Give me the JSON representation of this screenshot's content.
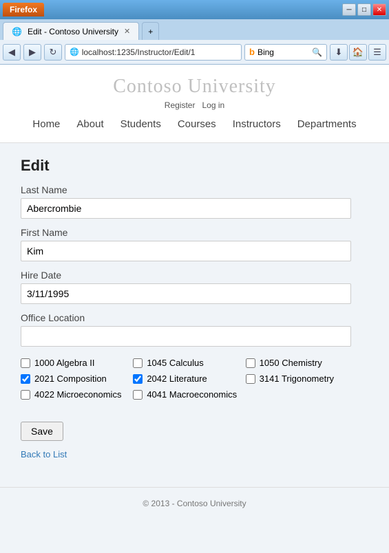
{
  "browser": {
    "firefox_label": "Firefox",
    "tab_title": "Edit - Contoso University",
    "tab_new_symbol": "+",
    "address": "localhost:1235/Instructor/Edit/1",
    "search_placeholder": "Bing",
    "search_engine": "Bing",
    "nav_back": "◀",
    "nav_forward": "▶",
    "nav_reload": "↻",
    "win_minimize": "─",
    "win_maximize": "□",
    "win_close": "✕"
  },
  "site": {
    "title": "Contoso University",
    "register_label": "Register",
    "login_label": "Log in",
    "nav_items": [
      "Home",
      "About",
      "Students",
      "Courses",
      "Instructors",
      "Departments"
    ],
    "footer_text": "© 2013 - Contoso University"
  },
  "page": {
    "heading": "Edit",
    "last_name_label": "Last Name",
    "last_name_value": "Abercrombie",
    "first_name_label": "First Name",
    "first_name_value": "Kim",
    "hire_date_label": "Hire Date",
    "hire_date_value": "3/11/1995",
    "office_location_label": "Office Location",
    "office_location_value": "",
    "save_label": "Save",
    "back_label": "Back to List"
  },
  "courses": [
    {
      "id": "1000",
      "name": "Algebra II",
      "checked": false
    },
    {
      "id": "1045",
      "name": "Calculus",
      "checked": false
    },
    {
      "id": "1050",
      "name": "Chemistry",
      "checked": false
    },
    {
      "id": "2021",
      "name": "Composition",
      "checked": true
    },
    {
      "id": "2042",
      "name": "Literature",
      "checked": true
    },
    {
      "id": "3141",
      "name": "Trigonometry",
      "checked": false
    },
    {
      "id": "4022",
      "name": "Microeconomics",
      "checked": false
    },
    {
      "id": "4041",
      "name": "Macroeconomics",
      "checked": false
    }
  ]
}
